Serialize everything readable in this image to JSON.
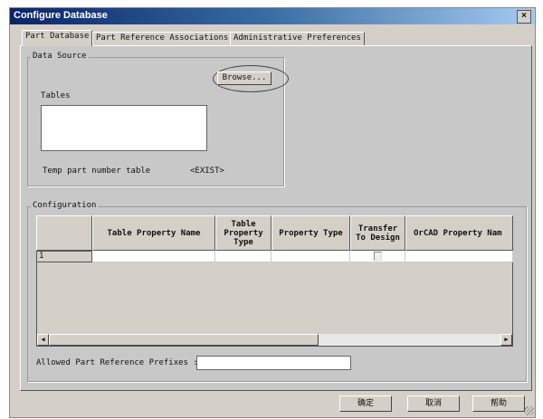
{
  "window": {
    "title": "Configure Database",
    "close_label": "×"
  },
  "tabs": [
    {
      "label": "Part Database",
      "active": true
    },
    {
      "label": "Part Reference Associations"
    },
    {
      "label": "Administrative Preferences"
    }
  ],
  "data_source": {
    "group_label": "Data Source",
    "browse_label": "Browse...",
    "tables_label": "Tables",
    "temp_label": "Temp part number table",
    "temp_value": "<EXIST>"
  },
  "configuration": {
    "group_label": "Configuration",
    "columns": [
      "",
      "Table Property Name",
      "Table Property Type",
      "Property Type",
      "Transfer To Design",
      "OrCAD Property Nam"
    ],
    "rows": [
      {
        "index": "1",
        "transfer_checked": false
      }
    ],
    "prefix_label": "Allowed Part Reference Prefixes :",
    "prefix_value": ""
  },
  "buttons": {
    "ok": "确定",
    "cancel": "取消",
    "help": "帮助"
  }
}
